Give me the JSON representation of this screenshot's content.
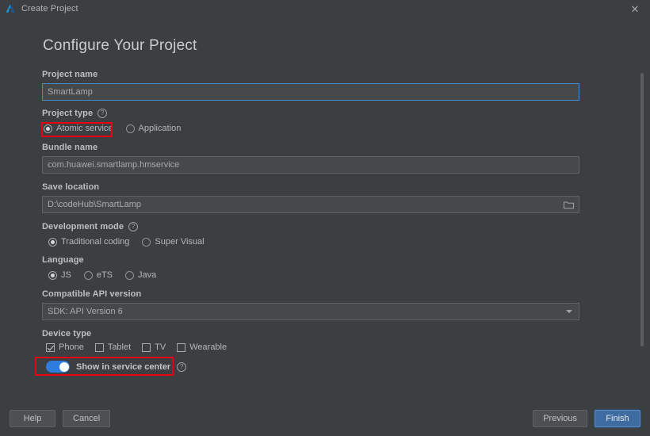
{
  "window": {
    "title": "Create Project",
    "logo_icon": "deveco-logo-icon",
    "close_icon": "close-icon"
  },
  "page": {
    "heading": "Configure Your Project"
  },
  "form": {
    "project_name": {
      "label": "Project name",
      "value": "SmartLamp",
      "placeholder": "Project name"
    },
    "project_type": {
      "label": "Project type",
      "help_icon": "help-circle-icon",
      "options": [
        {
          "label": "Atomic service",
          "selected": true
        },
        {
          "label": "Application",
          "selected": false
        }
      ]
    },
    "bundle_name": {
      "label": "Bundle name",
      "value": "com.huawei.smartlamp.hmservice",
      "placeholder": "Bundle name"
    },
    "save_location": {
      "label": "Save location",
      "value": "D:\\codeHub\\SmartLamp",
      "placeholder": "Save location",
      "browse_icon": "folder-icon"
    },
    "development_mode": {
      "label": "Development mode",
      "help_icon": "help-circle-icon",
      "options": [
        {
          "label": "Traditional coding",
          "selected": true
        },
        {
          "label": "Super Visual",
          "selected": false
        }
      ]
    },
    "language": {
      "label": "Language",
      "options": [
        {
          "label": "JS",
          "selected": true
        },
        {
          "label": "eTS",
          "selected": false
        },
        {
          "label": "Java",
          "selected": false
        }
      ]
    },
    "api_version": {
      "label": "Compatible API version",
      "value": "SDK: API Version 6",
      "dropdown_icon": "chevron-down-icon"
    },
    "device_type": {
      "label": "Device type",
      "options": [
        {
          "label": "Phone",
          "checked": true
        },
        {
          "label": "Tablet",
          "checked": false
        },
        {
          "label": "TV",
          "checked": false
        },
        {
          "label": "Wearable",
          "checked": false
        }
      ]
    },
    "service_center": {
      "label": "Show in service center",
      "help_icon": "help-circle-icon",
      "enabled": true
    }
  },
  "footer": {
    "help_label": "Help",
    "cancel_label": "Cancel",
    "previous_label": "Previous",
    "finish_label": "Finish"
  },
  "colors": {
    "background": "#3c3f41",
    "input_background": "#45494a",
    "accent_blue": "#2e7ddc",
    "primary_button": "#3e6ca0",
    "focus_border": "#4a88c7",
    "highlight_red": "#e60012",
    "text": "#b4b7b9"
  }
}
